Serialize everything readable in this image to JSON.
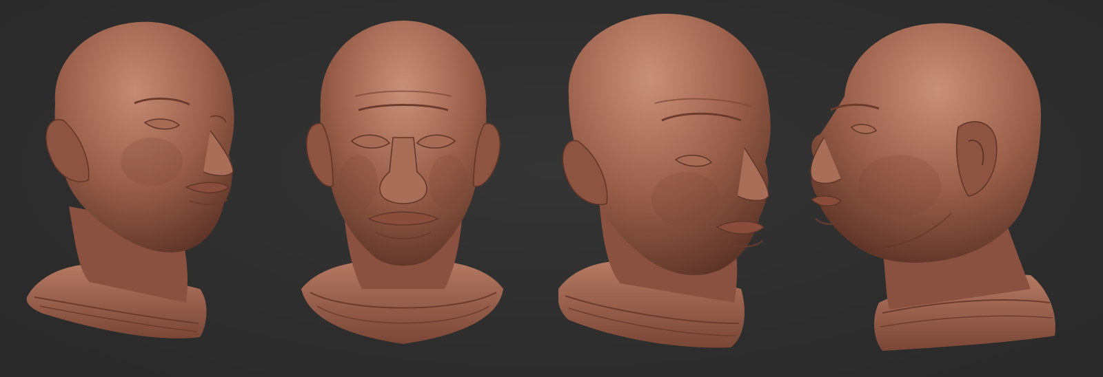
{
  "scene": {
    "background_color": "#2d2d2d",
    "clay_color": "#9a5f4a",
    "clay_highlight": "#c98f78",
    "clay_shadow": "#5a3428"
  },
  "views": [
    {
      "id": "three-quarter-right",
      "icon": "sculpt-head-three-quarter"
    },
    {
      "id": "front",
      "icon": "sculpt-head-front"
    },
    {
      "id": "three-quarter-right-low",
      "icon": "sculpt-head-three-quarter"
    },
    {
      "id": "profile-left",
      "icon": "sculpt-head-profile"
    }
  ]
}
